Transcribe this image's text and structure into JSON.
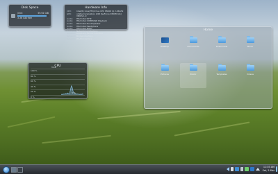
{
  "disk_space": {
    "title": "Disk Space",
    "drive": {
      "name": "/mnt",
      "size": "59.92 GiB",
      "free": "3.36 GiB free",
      "used_fraction": 0.94
    }
  },
  "hardware_info": {
    "title": "Hardware Info",
    "rows": [
      {
        "key": "CPU:",
        "value": "Intel(R) Core(TM)2 Duo CPU P8400 @ 2.26GHz"
      },
      {
        "key": "GPU:",
        "value": "nVidia Corporation G98 [GeForce 9300M GS]"
      },
      {
        "key": "",
        "value": "VBIOS 1.0"
      },
      {
        "key": "Audio:",
        "value": "HDA Intel ICH9"
      },
      {
        "key": "Audio:",
        "value": "HDA Intel COMMAND Playback"
      },
      {
        "key": "Audio:",
        "value": "HDA Intel Front Speaker"
      },
      {
        "key": "Audio:",
        "value": "HDA Intel Headphone"
      },
      {
        "key": "Audio:",
        "value": "HDA Intel SPDIF"
      },
      {
        "key": "Network:",
        "value": "Networking Interface"
      },
      {
        "key": "Network:",
        "value": "Loopback device Interface"
      },
      {
        "key": "Network:",
        "value": "Bridge Interface"
      },
      {
        "key": "Network:",
        "value": "WLAN Interface"
      }
    ]
  },
  "cpu_monitor": {
    "title": "CPU",
    "series_name": "Total",
    "ticks": [
      "100 %",
      "80 %",
      "60 %",
      "40 %",
      "20 %",
      "0 %"
    ],
    "current": "5 %",
    "samples": [
      2,
      3,
      2,
      4,
      3,
      6,
      4,
      8,
      5,
      3,
      20,
      35,
      28,
      12,
      6,
      4,
      3,
      5,
      4,
      3,
      2,
      3,
      2,
      4,
      3
    ],
    "color": "#8fc6f0"
  },
  "folder_view": {
    "title": "Home",
    "items": [
      {
        "label": "Desktop",
        "icon": "desktop-icon"
      },
      {
        "label": "Documents",
        "icon": "folder-icon"
      },
      {
        "label": "Downloads",
        "icon": "folder-icon"
      },
      {
        "label": "Music",
        "icon": "folder-icon"
      },
      {
        "label": "Pictures",
        "icon": "folder-icon"
      },
      {
        "label": "Public",
        "icon": "folder-icon"
      },
      {
        "label": "Templates",
        "icon": "folder-icon"
      },
      {
        "label": "Videos",
        "icon": "folder-icon"
      }
    ]
  },
  "taskbar": {
    "clock_time": "11:03 AM",
    "clock_date": "Sat, 5 Mar"
  }
}
